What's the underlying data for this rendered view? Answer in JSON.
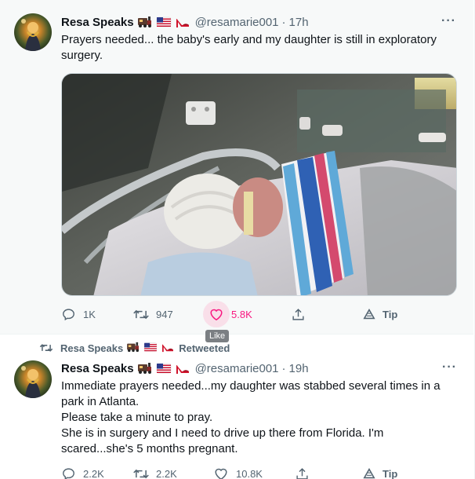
{
  "tweets": [
    {
      "author": {
        "name": "Resa Speaks",
        "handle": "@resamarie001",
        "emojis": [
          "train-emoji",
          "us-flag-emoji",
          "high-heel-emoji"
        ]
      },
      "time": "17h",
      "text": [
        "Prayers needed... the baby's early and my daughter is still in exploratory surgery."
      ],
      "media": {
        "description_icon": "photo"
      },
      "stats": {
        "replies": "1K",
        "retweets": "947",
        "likes": "5.8K",
        "tip": "Tip"
      },
      "liked_hover": true,
      "tooltip": "Like"
    },
    {
      "retweet_context": {
        "name": "Resa Speaks",
        "label": "Retweeted"
      },
      "author": {
        "name": "Resa Speaks",
        "handle": "@resamarie001",
        "emojis": [
          "train-emoji",
          "us-flag-emoji",
          "high-heel-emoji"
        ]
      },
      "time": "19h",
      "text": [
        "Immediate prayers needed...my daughter was stabbed several times in a park in Atlanta.",
        "Please take a minute to pray.",
        "She is in surgery and I need to drive up there from Florida. I'm scared...she's 5 months pregnant."
      ],
      "stats": {
        "replies": "2.2K",
        "retweets": "2.2K",
        "likes": "10.8K",
        "tip": "Tip"
      }
    }
  ],
  "colors": {
    "like_pink": "#f91880",
    "secondary_text": "#536471",
    "hover_bg": "#f7f9f9"
  },
  "separator_dot": "·",
  "more_glyph": "···"
}
